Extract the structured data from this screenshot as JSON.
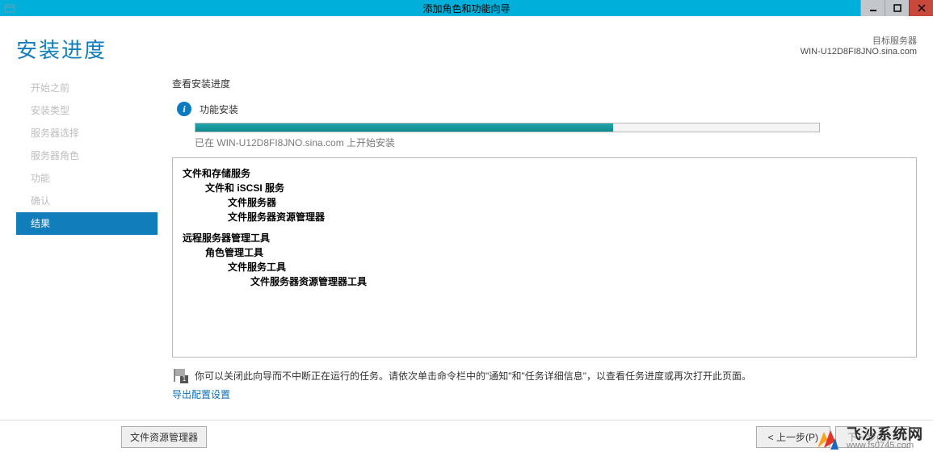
{
  "window": {
    "title": "添加角色和功能向导"
  },
  "header": {
    "page_title": "安装进度",
    "target_label": "目标服务器",
    "target_value": "WIN-U12D8FI8JNO.sina.com"
  },
  "sidebar": {
    "items": [
      {
        "label": "开始之前"
      },
      {
        "label": "安装类型"
      },
      {
        "label": "服务器选择"
      },
      {
        "label": "服务器角色"
      },
      {
        "label": "功能"
      },
      {
        "label": "确认"
      },
      {
        "label": "结果"
      }
    ]
  },
  "main": {
    "section_label": "查看安装进度",
    "install_label": "功能安装",
    "progress_text": "已在 WIN-U12D8FI8JNO.sina.com 上开始安装",
    "features": {
      "g1_l1": "文件和存储服务",
      "g1_l2": "文件和 iSCSI 服务",
      "g1_l3a": "文件服务器",
      "g1_l3b": "文件服务器资源管理器",
      "g2_l1": "远程服务器管理工具",
      "g2_l2": "角色管理工具",
      "g2_l3": "文件服务工具",
      "g2_l4": "文件服务器资源管理器工具"
    },
    "note_badge": "1",
    "note_text": "你可以关闭此向导而不中断正在运行的任务。请依次单击命令栏中的\"通知\"和\"任务详细信息\"，以查看任务进度或再次打开此页面。",
    "export_link": "导出配置设置"
  },
  "footer": {
    "small_button": "文件资源管理器",
    "prev": "< 上一步(P)",
    "next": "下一步(N) >",
    "dropdown_hint": "▾"
  },
  "watermark": {
    "big": "飞沙系统网",
    "small": "www.fs0745.com"
  }
}
